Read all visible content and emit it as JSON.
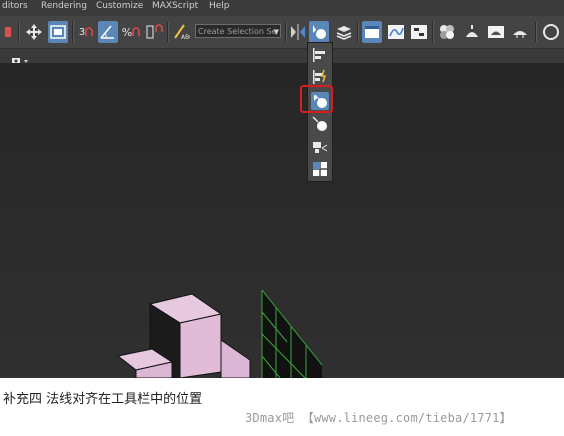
{
  "menu": {
    "items": [
      "ditors",
      "Rendering",
      "Customize",
      "MAXScript",
      "Help"
    ]
  },
  "toolbar": {
    "selection_set_placeholder": "Create Selection Se",
    "snap_angle_label": "3",
    "percent_snap_label": "%",
    "accent_color": "#5b86b8"
  },
  "flyout": {
    "items": [
      "align-icon",
      "quick-align-icon",
      "normal-align-icon",
      "place-highlight-icon",
      "align-camera-icon",
      "align-to-view-icon"
    ],
    "highlight_color": "#d61e1e"
  },
  "caption": {
    "text": "补充四 法线对齐在工具栏中的位置"
  },
  "watermark": {
    "text": "3Dmax吧 【www.lineeg.com/tieba/1771】"
  }
}
